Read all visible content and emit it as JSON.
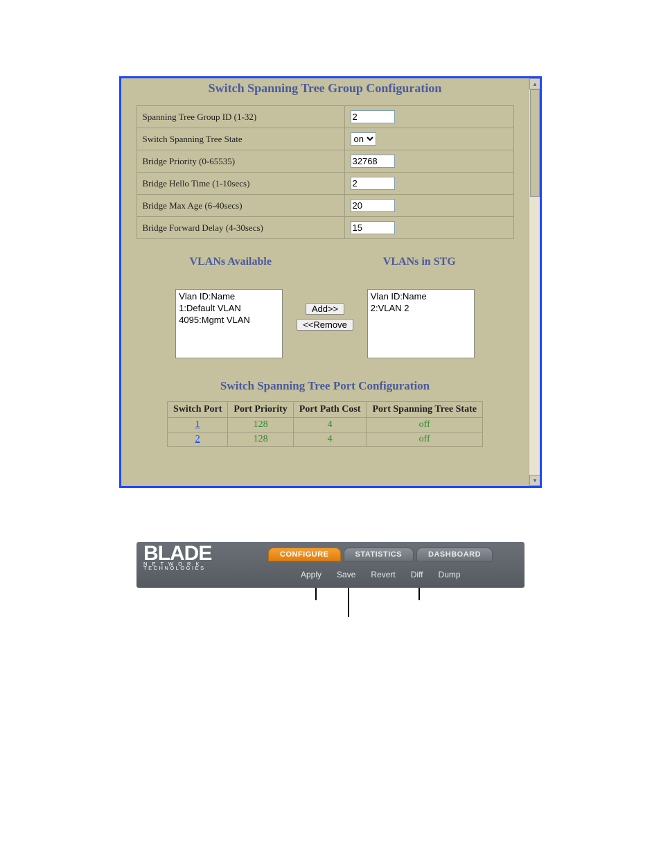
{
  "panel1": {
    "title": "Switch Spanning Tree Group Configuration",
    "rows": [
      {
        "label": "Spanning Tree Group ID (1-32)",
        "type": "text",
        "value": "2"
      },
      {
        "label": "Switch Spanning Tree State",
        "type": "select",
        "value": "on"
      },
      {
        "label": "Bridge Priority (0-65535)",
        "type": "text",
        "value": "32768"
      },
      {
        "label": "Bridge Hello Time (1-10secs)",
        "type": "text",
        "value": "2"
      },
      {
        "label": "Bridge Max Age (6-40secs)",
        "type": "text",
        "value": "20"
      },
      {
        "label": "Bridge Forward Delay (4-30secs)",
        "type": "text",
        "value": "15"
      }
    ],
    "vlan_heading_left": "VLANs Available",
    "vlan_heading_right": "VLANs in STG",
    "vlan_box_header": "Vlan ID:Name",
    "vlans_available": [
      "1:Default VLAN",
      "4095:Mgmt VLAN"
    ],
    "vlans_in_stg": [
      "2:VLAN 2"
    ],
    "btn_add": "Add>>",
    "btn_remove": "<<Remove",
    "port_title": "Switch Spanning Tree Port Configuration",
    "port_headers": [
      "Switch Port",
      "Port Priority",
      "Port Path Cost",
      "Port Spanning Tree  State"
    ],
    "port_rows": [
      {
        "port": "1",
        "priority": "128",
        "cost": "4",
        "state": "off"
      },
      {
        "port": "2",
        "priority": "128",
        "cost": "4",
        "state": "off"
      }
    ]
  },
  "panel2": {
    "logo_main": "BLADE",
    "logo_sub1": "N E T W O R K",
    "logo_sub2": "TECHNOLOGIES",
    "tabs": [
      {
        "label": "CONFIGURE",
        "active": true
      },
      {
        "label": "STATISTICS",
        "active": false
      },
      {
        "label": "DASHBOARD",
        "active": false
      }
    ],
    "menu": [
      "Apply",
      "Save",
      "Revert",
      "Diff",
      "Dump"
    ]
  }
}
